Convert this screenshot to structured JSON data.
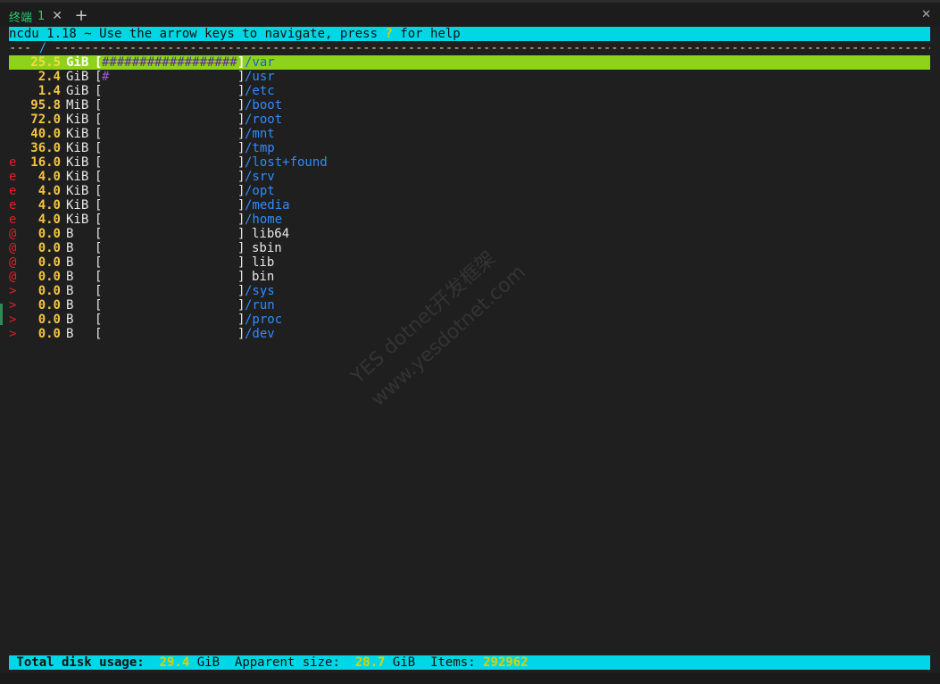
{
  "tab": {
    "title": "终端",
    "number": "1",
    "close_glyph": "✕",
    "add_glyph": "+",
    "window_close_glyph": "✕"
  },
  "header": {
    "prefix": "ncdu 1.18 ~ Use the arrow keys to navigate, press ",
    "help_key": "?",
    "suffix": " for help"
  },
  "path_line": {
    "dashes_before": "--- ",
    "path": "/",
    "dashes_after": " -------------------------------------------------------------------------------------------------------------------------"
  },
  "entries": [
    {
      "flag": "",
      "size": "25.5",
      "unit": "GiB",
      "bar": "##################",
      "name": "/var",
      "dir": true,
      "selected": true
    },
    {
      "flag": "",
      "size": "2.4",
      "unit": "GiB",
      "bar": "#",
      "name": "/usr",
      "dir": true,
      "selected": false
    },
    {
      "flag": "",
      "size": "1.4",
      "unit": "GiB",
      "bar": "",
      "name": "/etc",
      "dir": true,
      "selected": false
    },
    {
      "flag": "",
      "size": "95.8",
      "unit": "MiB",
      "bar": "",
      "name": "/boot",
      "dir": true,
      "selected": false
    },
    {
      "flag": "",
      "size": "72.0",
      "unit": "KiB",
      "bar": "",
      "name": "/root",
      "dir": true,
      "selected": false
    },
    {
      "flag": "",
      "size": "40.0",
      "unit": "KiB",
      "bar": "",
      "name": "/mnt",
      "dir": true,
      "selected": false
    },
    {
      "flag": "",
      "size": "36.0",
      "unit": "KiB",
      "bar": "",
      "name": "/tmp",
      "dir": true,
      "selected": false
    },
    {
      "flag": "e",
      "size": "16.0",
      "unit": "KiB",
      "bar": "",
      "name": "/lost+found",
      "dir": true,
      "selected": false
    },
    {
      "flag": "e",
      "size": "4.0",
      "unit": "KiB",
      "bar": "",
      "name": "/srv",
      "dir": true,
      "selected": false
    },
    {
      "flag": "e",
      "size": "4.0",
      "unit": "KiB",
      "bar": "",
      "name": "/opt",
      "dir": true,
      "selected": false
    },
    {
      "flag": "e",
      "size": "4.0",
      "unit": "KiB",
      "bar": "",
      "name": "/media",
      "dir": true,
      "selected": false
    },
    {
      "flag": "e",
      "size": "4.0",
      "unit": "KiB",
      "bar": "",
      "name": "/home",
      "dir": true,
      "selected": false
    },
    {
      "flag": "@",
      "size": "0.0",
      "unit": "B",
      "bar": "",
      "name": "lib64",
      "dir": false,
      "selected": false
    },
    {
      "flag": "@",
      "size": "0.0",
      "unit": "B",
      "bar": "",
      "name": "sbin",
      "dir": false,
      "selected": false
    },
    {
      "flag": "@",
      "size": "0.0",
      "unit": "B",
      "bar": "",
      "name": "lib",
      "dir": false,
      "selected": false
    },
    {
      "flag": "@",
      "size": "0.0",
      "unit": "B",
      "bar": "",
      "name": "bin",
      "dir": false,
      "selected": false
    },
    {
      "flag": ">",
      "size": "0.0",
      "unit": "B",
      "bar": "",
      "name": "/sys",
      "dir": true,
      "selected": false
    },
    {
      "flag": ">",
      "size": "0.0",
      "unit": "B",
      "bar": "",
      "name": "/run",
      "dir": true,
      "selected": false
    },
    {
      "flag": ">",
      "size": "0.0",
      "unit": "B",
      "bar": "",
      "name": "/proc",
      "dir": true,
      "selected": false
    },
    {
      "flag": ">",
      "size": "0.0",
      "unit": "B",
      "bar": "",
      "name": "/dev",
      "dir": true,
      "selected": false
    }
  ],
  "bar_brackets": {
    "open": "[",
    "close": "]"
  },
  "footer": {
    "total_label": " Total disk usage:",
    "total_value": "29.4",
    "total_unit": "GiB",
    "apparent_label": "Apparent size:",
    "apparent_value": "28.7",
    "apparent_unit": "GiB",
    "items_label": "Items:",
    "items_value": "292962"
  },
  "watermark": {
    "line1": "YES  dotnet开发框架",
    "line2": "www.yesdotnet.com"
  },
  "colors": {
    "header_bg": "#00d7e6",
    "selected_bg": "#8fd21c",
    "size_yellow": "#f4c542",
    "dir_blue": "#2f8cff",
    "flag_red": "#e02020",
    "bar_purple": "#9b59d0"
  }
}
